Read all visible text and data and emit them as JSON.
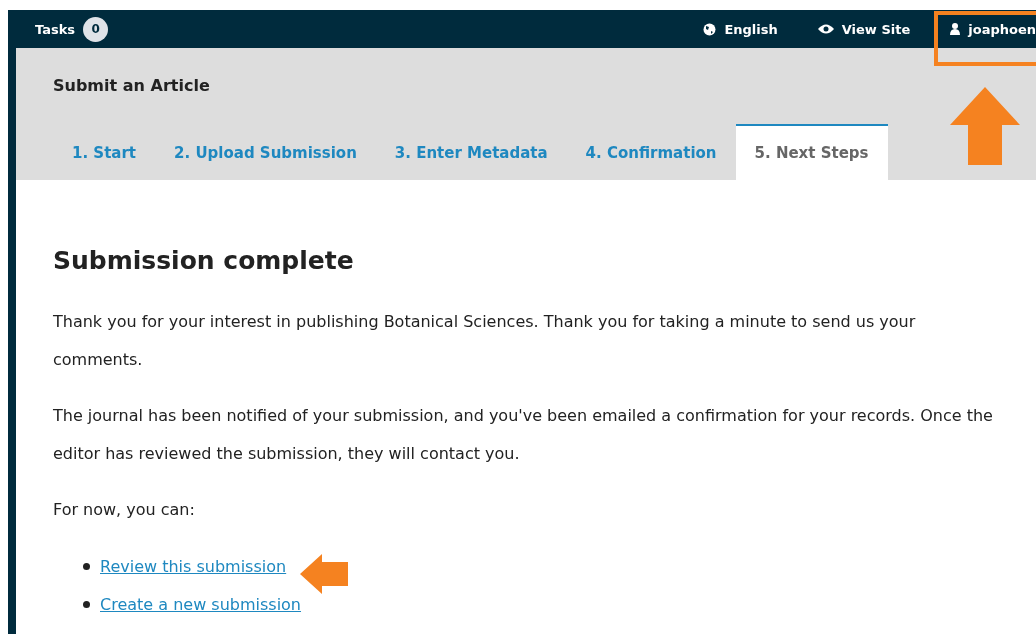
{
  "top_bar": {
    "tasks": {
      "label": "Tasks",
      "count": "0"
    },
    "language": "English",
    "view_site": "View Site",
    "user": "joaphoen"
  },
  "header": {
    "title": "Submit an Article"
  },
  "tabs": [
    {
      "label": "1. Start",
      "selected": false
    },
    {
      "label": "2. Upload Submission",
      "selected": false
    },
    {
      "label": "3. Enter Metadata",
      "selected": false
    },
    {
      "label": "4. Confirmation",
      "selected": false
    },
    {
      "label": "5. Next Steps",
      "selected": true
    }
  ],
  "content": {
    "heading": "Submission complete",
    "paragraphs": [
      "Thank you for your interest in publishing Botanical Sciences. Thank you for taking a minute to send us your comments.",
      "The journal has been notified of your submission, and you've been emailed a confirmation for your records. Once the editor has reviewed the submission, they will contact you.",
      "For now, you can:"
    ],
    "links": [
      "Review this submission",
      "Create a new submission"
    ]
  }
}
